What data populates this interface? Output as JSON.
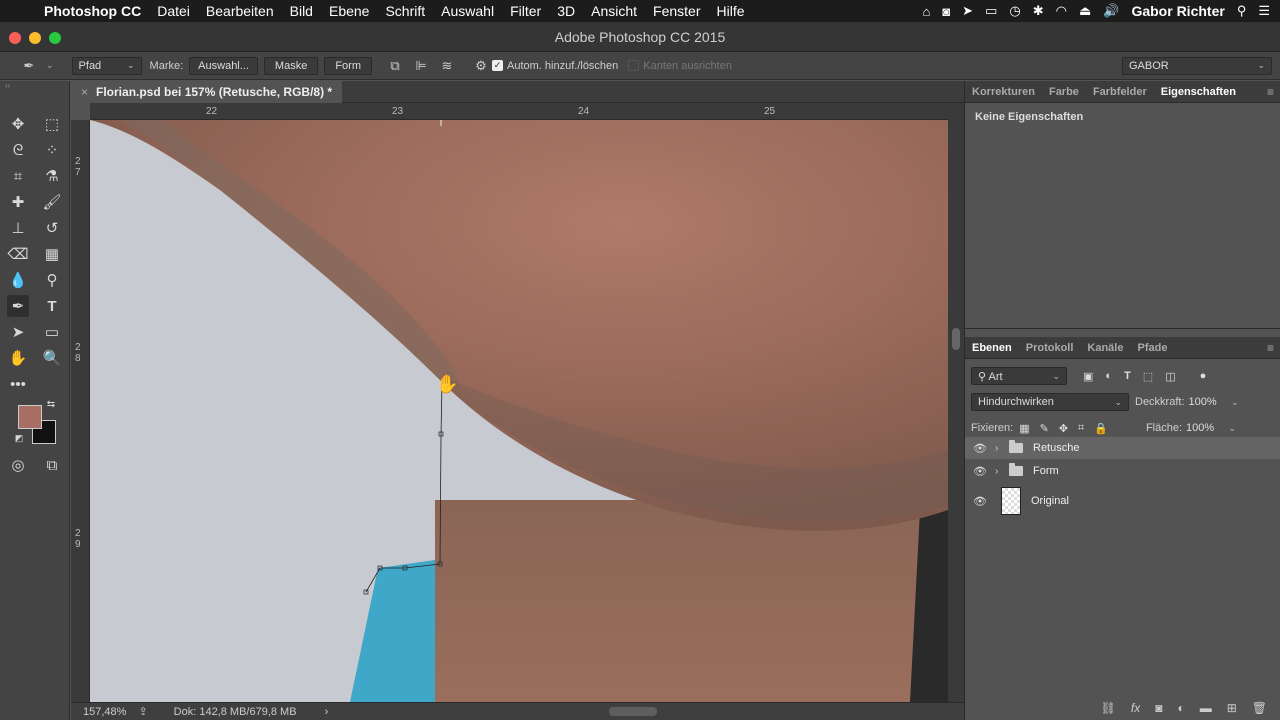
{
  "menubar": {
    "app_name": "Photoshop CC",
    "items": [
      "Datei",
      "Bearbeiten",
      "Bild",
      "Ebene",
      "Schrift",
      "Auswahl",
      "Filter",
      "3D",
      "Ansicht",
      "Fenster",
      "Hilfe"
    ],
    "user": "Gabor Richter"
  },
  "window": {
    "title": "Adobe Photoshop CC 2015"
  },
  "options": {
    "mode_select": "Pfad",
    "marke_label": "Marke:",
    "auswahl_button": "Auswahl...",
    "maske_button": "Maske",
    "form_button": "Form",
    "auto_add_label": "Autom. hinzuf./löschen",
    "align_edges_label": "Kanten ausrichten",
    "workspace": "GABOR"
  },
  "document": {
    "tab_title": "Florian.psd bei 157% (Retusche, RGB/8) *",
    "ruler_top": [
      "22",
      "23",
      "24",
      "25"
    ],
    "ruler_left": [
      "27",
      "28",
      "29"
    ],
    "zoom": "157,48%",
    "doc_size": "Dok: 142,8 MB/679,8 MB"
  },
  "properties_panel": {
    "tabs": [
      "Korrekturen",
      "Farbe",
      "Farbfelder",
      "Eigenschaften"
    ],
    "active_tab": "Eigenschaften",
    "empty_text": "Keine Eigenschaften"
  },
  "layers_panel": {
    "tabs": [
      "Ebenen",
      "Protokoll",
      "Kanäle",
      "Pfade"
    ],
    "filter_select": "Art",
    "blend_mode": "Hindurchwirken",
    "opacity_label": "Deckkraft:",
    "opacity_value": "100%",
    "lock_label": "Fixieren:",
    "fill_label": "Fläche:",
    "fill_value": "100%",
    "layers": [
      {
        "name": "Retusche",
        "type": "group",
        "selected": true
      },
      {
        "name": "Form",
        "type": "group",
        "selected": false
      },
      {
        "name": "Original",
        "type": "smart-object",
        "selected": false
      }
    ]
  },
  "colors": {
    "foreground": "#a86e64",
    "background": "#111111",
    "accent_selection": "#656565"
  }
}
